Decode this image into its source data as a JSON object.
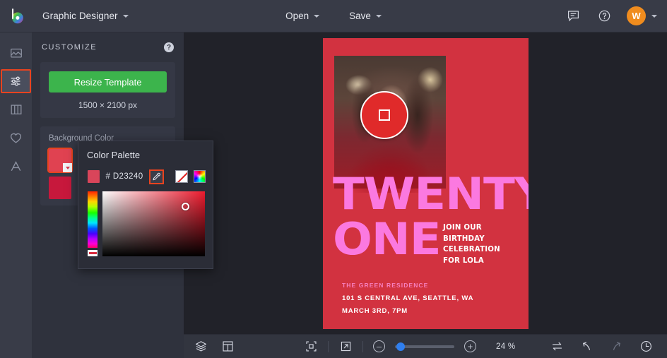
{
  "header": {
    "logo_icon": "color-wheel-logo",
    "doc_title": "Graphic Designer",
    "open_label": "Open",
    "save_label": "Save",
    "comment_icon": "comment-icon",
    "help_icon": "help-circle-icon",
    "avatar_initial": "W"
  },
  "rail": {
    "items": [
      {
        "icon": "image-icon",
        "name": "sidebar-item-images"
      },
      {
        "icon": "sliders-icon",
        "name": "sidebar-item-customize"
      },
      {
        "icon": "columns-icon",
        "name": "sidebar-item-layouts"
      },
      {
        "icon": "heart-icon",
        "name": "sidebar-item-favorites"
      },
      {
        "icon": "text-icon",
        "name": "sidebar-item-text"
      }
    ]
  },
  "panel": {
    "title": "CUSTOMIZE",
    "help_icon": "help-circle-icon",
    "resize_label": "Resize Template",
    "dimensions": "1500 × 2100 px",
    "bg_label": "Background Color",
    "swatches": [
      {
        "color": "#e04251",
        "selected": true
      },
      {
        "color": "#c7183c",
        "selected": false
      },
      {
        "color": "#f5f5f5",
        "selected": false
      },
      {
        "color": "#e0a61c",
        "selected": false
      }
    ]
  },
  "popup": {
    "title": "Color Palette",
    "hex": "# D23240",
    "preview_color": "#d9455a",
    "eyedropper_icon": "eyedropper-icon",
    "no_color_icon": "no-color-swatch",
    "rainbow_icon": "rainbow-swatch"
  },
  "canvas": {
    "poster": {
      "bg_color": "#d23240",
      "picker_icon": "color-picker-circle",
      "picked_color": "#e02a2a",
      "headline_1": "TWENTY",
      "headline_2": "ONE",
      "headline_color": "#fb79e0",
      "subtext": "JOIN OUR\nBIRTHDAY\nCELEBRATION\nFOR LOLA",
      "footer_1": "THE GREEN RESIDENCE",
      "footer_2": "101 S CENTRAL AVE, SEATTLE, WA",
      "footer_3": "MARCH 3RD, 7PM"
    }
  },
  "bottombar": {
    "layers_icon": "layers-icon",
    "grid_icon": "grid-layout-icon",
    "fit_icon": "fit-to-screen-icon",
    "expand_icon": "expand-arrow-icon",
    "zoom_out_label": "–",
    "zoom_in_label": "+",
    "zoom_value": "24 %",
    "swap_icon": "swap-arrows-icon",
    "undo_icon": "undo-icon",
    "redo_icon": "redo-icon",
    "history_icon": "history-clock-icon"
  }
}
